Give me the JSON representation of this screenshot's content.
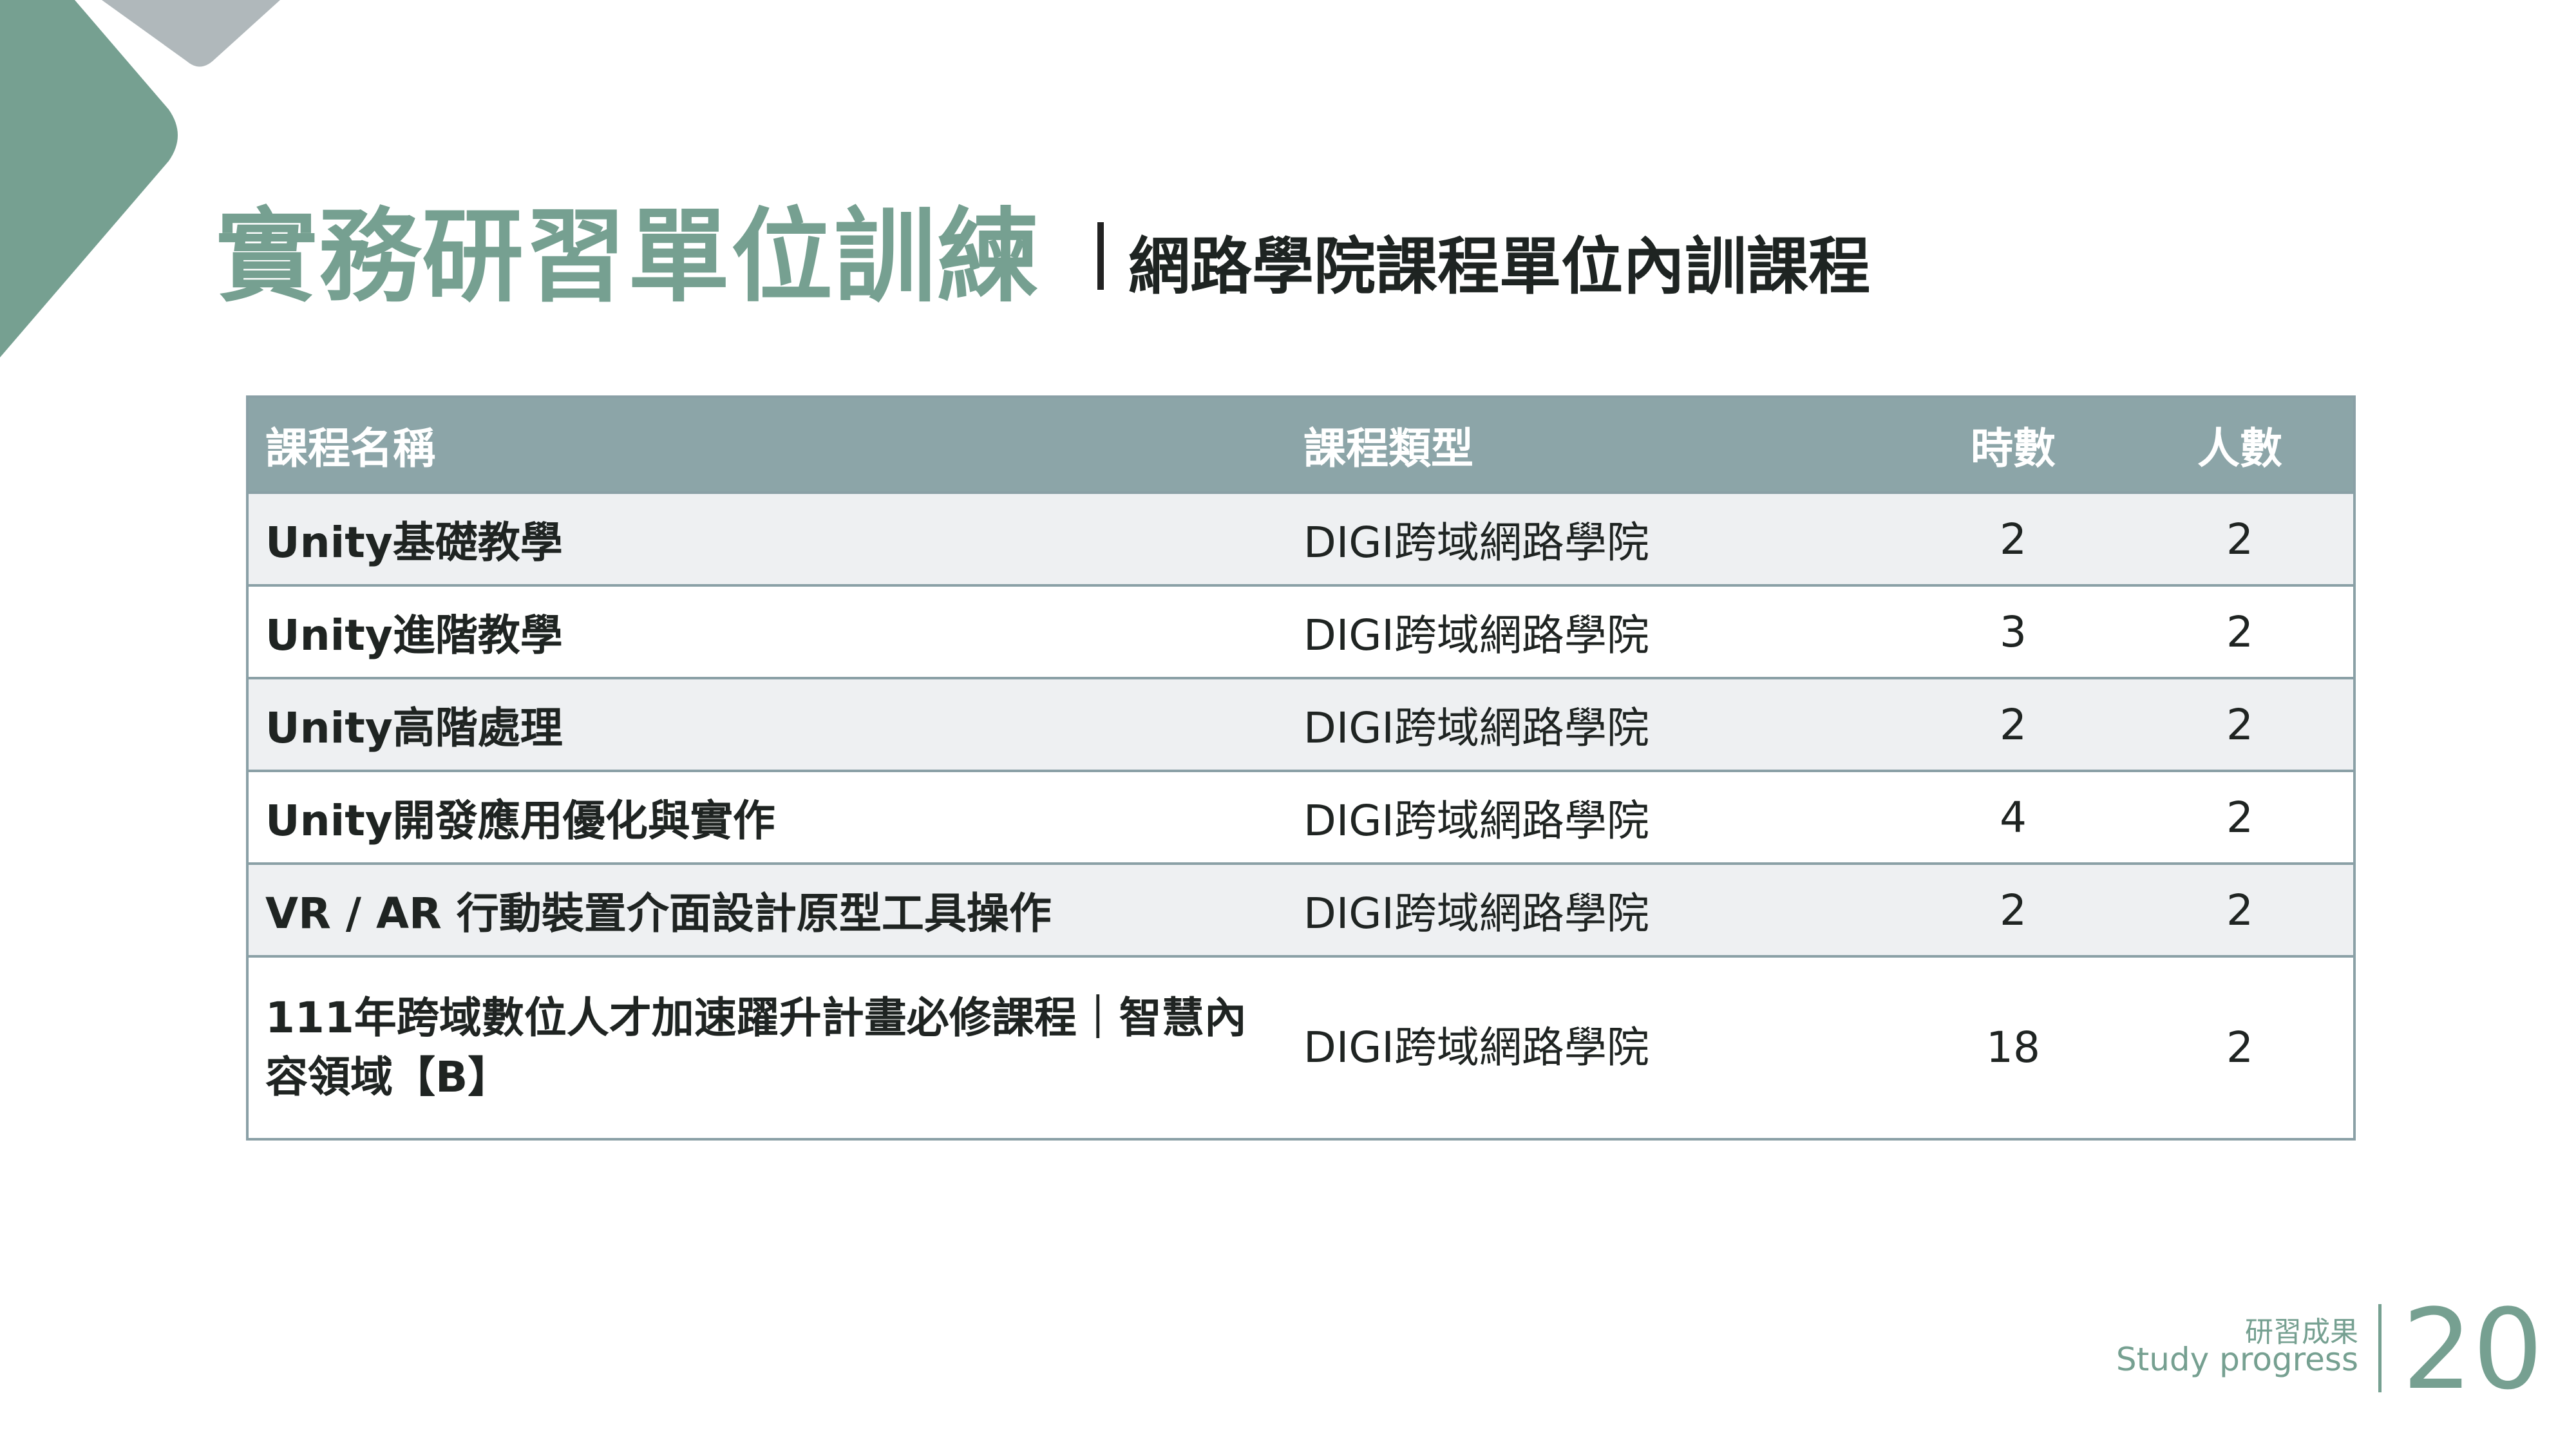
{
  "header": {
    "title": "實務研習單位訓練",
    "subtitle": "網路學院課程單位內訓課程"
  },
  "table": {
    "columns": [
      "課程名稱",
      "課程類型",
      "時數",
      "人數"
    ],
    "rows": [
      {
        "name": "Unity基礎教學",
        "type": "DIGI跨域網路學院",
        "hours": "2",
        "people": "2"
      },
      {
        "name": "Unity進階教學",
        "type": "DIGI跨域網路學院",
        "hours": "3",
        "people": "2"
      },
      {
        "name": "Unity高階處理",
        "type": "DIGI跨域網路學院",
        "hours": "2",
        "people": "2"
      },
      {
        "name": "Unity開發應用優化與實作",
        "type": "DIGI跨域網路學院",
        "hours": "4",
        "people": "2"
      },
      {
        "name": "VR / AR 行動裝置介面設計原型工具操作",
        "type": "DIGI跨域網路學院",
        "hours": "2",
        "people": "2"
      },
      {
        "name": "111年跨域數位人才加速躍升計畫必修課程｜智慧內容領域【B】",
        "type": "DIGI跨域網路學院",
        "hours": "18",
        "people": "2"
      }
    ]
  },
  "footer": {
    "section_cn": "研習成果",
    "section_en": "Study progress",
    "page_number": "20"
  },
  "colors": {
    "accent": "#76a091",
    "header_bg": "#8ca5a8",
    "alt_row": "#eef0f2",
    "deco_grey": "#b0b8bb"
  }
}
